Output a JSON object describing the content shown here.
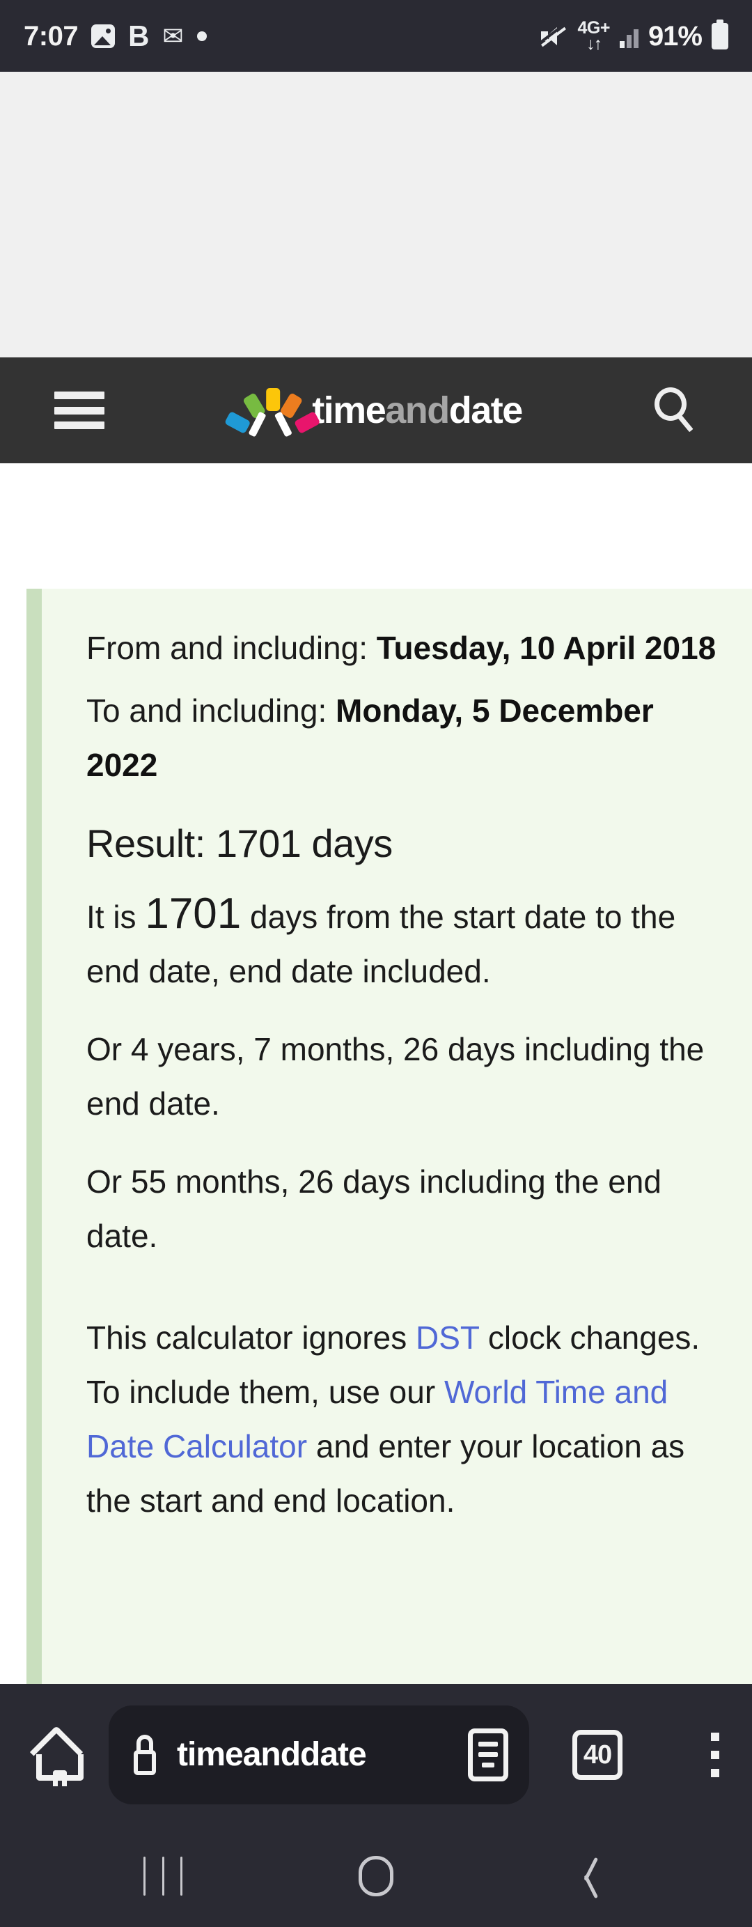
{
  "status_bar": {
    "time": "7:07",
    "left_icons": [
      {
        "name": "photo-icon",
        "glyph": "image"
      },
      {
        "name": "bluetooth-letter-icon",
        "glyph": "B"
      },
      {
        "name": "app-notification-icon",
        "glyph": "✉"
      },
      {
        "name": "dot-notification-icon",
        "glyph": "•"
      }
    ],
    "mute_icon": "mute-icon",
    "network_type": "4G+",
    "network_arrows": "↓↑",
    "signal_icon": "signal-bars-icon",
    "battery_percent": "91%",
    "battery_icon": "battery-icon"
  },
  "site_header": {
    "menu_icon": "hamburger-menu-icon",
    "brand_part_1": "time",
    "brand_part_2": "and",
    "brand_part_3": "date",
    "search_icon": "search-icon",
    "logo_colors": {
      "blue": "#1f9ad6",
      "green": "#77bb41",
      "yellow": "#fcc60a",
      "orange": "#ed7d1f",
      "pink": "#e8156c"
    },
    "header_bg": "#333333"
  },
  "result": {
    "from_label": "From and including: ",
    "from_date": "Tuesday, 10 April 2018",
    "to_label": "To and including: ",
    "to_date": "Monday, 5 December 2022",
    "heading": "Result: 1701 days",
    "days_count": "1701",
    "sentence_prefix": "It is ",
    "sentence_suffix": " days from the start date to the end date, end date included.",
    "alt_duration_1": "Or 4 years, 7 months, 26 days including the end date.",
    "alt_duration_2": "Or 55 months, 26 days including the end date.",
    "dst_part_1": "This calculator ignores ",
    "dst_link_1": "DST",
    "dst_part_2": " clock changes. To include them, use our ",
    "dst_link_2": "World Time and Date Calculator",
    "dst_part_3": " and enter your location as the start and end location.",
    "box_bg": "#f2f9ec",
    "box_accent": "#c9dfbe",
    "link_color": "#5068d6"
  },
  "browser_bar": {
    "home_icon": "home-icon",
    "lock_icon": "lock-icon",
    "url_text": "timeanddate",
    "reader_icon": "reader-mode-icon",
    "tab_count": "40",
    "menu_icon": "overflow-menu-icon",
    "bar_bg": "#2a2a33"
  },
  "nav_bar": {
    "recents_icon": "recents-icon",
    "home_icon": "home-pill-icon",
    "back_icon": "back-chevron-icon"
  }
}
